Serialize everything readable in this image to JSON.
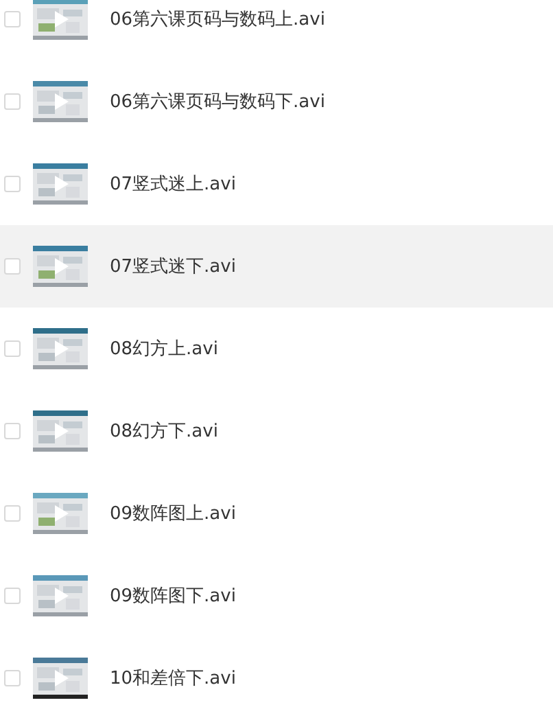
{
  "files": [
    {
      "name": "06第六课页码与数码上.avi",
      "checked": false,
      "highlighted": false
    },
    {
      "name": "06第六课页码与数码下.avi",
      "checked": false,
      "highlighted": false
    },
    {
      "name": "07竖式迷上.avi",
      "checked": false,
      "highlighted": false
    },
    {
      "name": "07竖式迷下.avi",
      "checked": false,
      "highlighted": true
    },
    {
      "name": "08幻方上.avi",
      "checked": false,
      "highlighted": false
    },
    {
      "name": "08幻方下.avi",
      "checked": false,
      "highlighted": false
    },
    {
      "name": "09数阵图上.avi",
      "checked": false,
      "highlighted": false
    },
    {
      "name": "09数阵图下.avi",
      "checked": false,
      "highlighted": false
    },
    {
      "name": "10和差倍下.avi",
      "checked": false,
      "highlighted": false
    }
  ]
}
